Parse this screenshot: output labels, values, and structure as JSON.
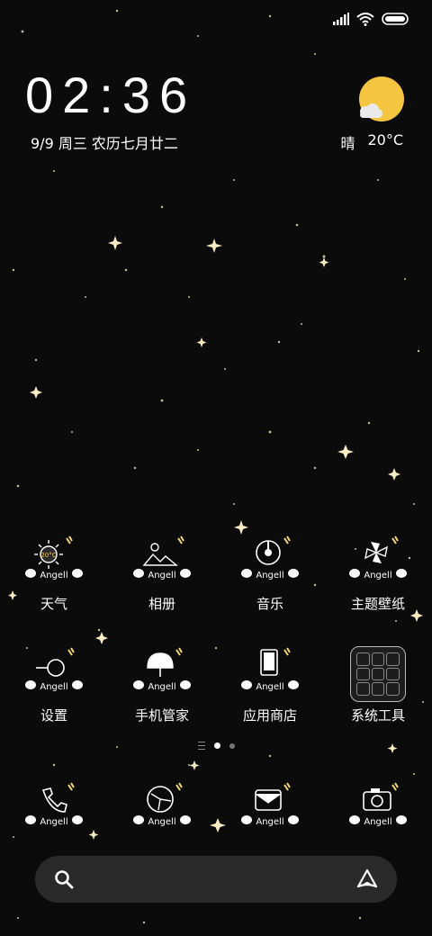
{
  "status_bar": {
    "icons": [
      "signal-icon",
      "wifi-icon",
      "battery-icon"
    ]
  },
  "clock": {
    "time": "02:36"
  },
  "date": {
    "text": "9/9 周三 农历七月廿二"
  },
  "weather": {
    "condition": "晴",
    "temperature": "20°C",
    "icon": "sun-cloud-icon"
  },
  "apps_row1": [
    {
      "label": "天气",
      "icon": "weather-sun-icon",
      "badge": "Angell",
      "mini": "20°C"
    },
    {
      "label": "相册",
      "icon": "gallery-icon",
      "badge": "Angell"
    },
    {
      "label": "音乐",
      "icon": "music-disc-icon",
      "badge": "Angell"
    },
    {
      "label": "主题壁纸",
      "icon": "themes-icon",
      "badge": "Angell"
    }
  ],
  "apps_row2": [
    {
      "label": "设置",
      "icon": "settings-icon",
      "badge": "Angell"
    },
    {
      "label": "手机管家",
      "icon": "security-umbrella-icon",
      "badge": "Angell"
    },
    {
      "label": "应用商店",
      "icon": "app-store-icon",
      "badge": "Angell"
    },
    {
      "label": "系统工具",
      "icon": "folder-icon"
    }
  ],
  "dock": [
    {
      "icon": "phone-icon",
      "badge": "Angell"
    },
    {
      "icon": "browser-icon",
      "badge": "Angell"
    },
    {
      "icon": "messages-icon",
      "badge": "Angell"
    },
    {
      "icon": "camera-icon",
      "badge": "Angell"
    }
  ],
  "page_indicator": {
    "pages": 2,
    "current": 1
  },
  "search_bar": {
    "left_icon": "search-icon",
    "right_icon": "assistant-icon"
  },
  "colors": {
    "background": "#0b0b0b",
    "sun": "#f5c542",
    "search_bg": "#2a2a2a",
    "star": "#f3e6b0"
  }
}
